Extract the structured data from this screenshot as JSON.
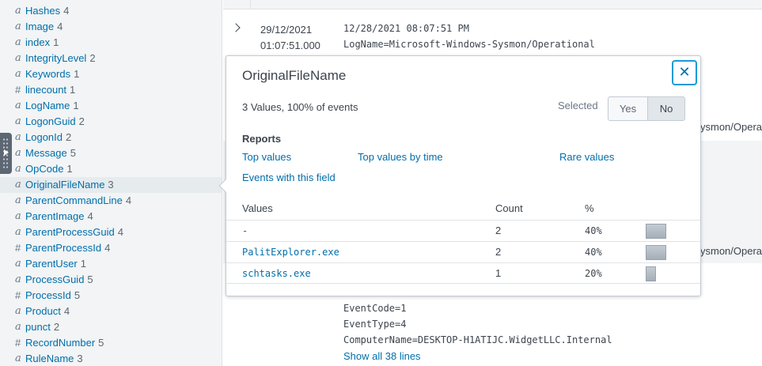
{
  "sidebar": {
    "fields": [
      {
        "type": "a",
        "name": "Hashes",
        "count": "4"
      },
      {
        "type": "a",
        "name": "Image",
        "count": "4"
      },
      {
        "type": "a",
        "name": "index",
        "count": "1"
      },
      {
        "type": "a",
        "name": "IntegrityLevel",
        "count": "2"
      },
      {
        "type": "a",
        "name": "Keywords",
        "count": "1"
      },
      {
        "type": "#",
        "name": "linecount",
        "count": "1"
      },
      {
        "type": "a",
        "name": "LogName",
        "count": "1"
      },
      {
        "type": "a",
        "name": "LogonGuid",
        "count": "2"
      },
      {
        "type": "a",
        "name": "LogonId",
        "count": "2"
      },
      {
        "type": "a",
        "name": "Message",
        "count": "5"
      },
      {
        "type": "a",
        "name": "OpCode",
        "count": "1"
      },
      {
        "type": "a",
        "name": "OriginalFileName",
        "count": "3"
      },
      {
        "type": "a",
        "name": "ParentCommandLine",
        "count": "4"
      },
      {
        "type": "a",
        "name": "ParentImage",
        "count": "4"
      },
      {
        "type": "a",
        "name": "ParentProcessGuid",
        "count": "4"
      },
      {
        "type": "#",
        "name": "ParentProcessId",
        "count": "4"
      },
      {
        "type": "a",
        "name": "ParentUser",
        "count": "1"
      },
      {
        "type": "a",
        "name": "ProcessGuid",
        "count": "5"
      },
      {
        "type": "#",
        "name": "ProcessId",
        "count": "5"
      },
      {
        "type": "a",
        "name": "Product",
        "count": "4"
      },
      {
        "type": "a",
        "name": "punct",
        "count": "2"
      },
      {
        "type": "#",
        "name": "RecordNumber",
        "count": "5"
      },
      {
        "type": "a",
        "name": "RuleName",
        "count": "3"
      }
    ]
  },
  "event": {
    "date": "29/12/2021",
    "time": "01:07:51.000",
    "lines": [
      "12/28/2021 08:07:51 PM",
      "LogName=Microsoft-Windows-Sysmon/Operational"
    ],
    "lines_bottom": [
      "EventCode=1",
      "EventType=4",
      "ComputerName=DESKTOP-H1ATIJC.WidgetLLC.Internal"
    ],
    "right_fragment_1": "ysmon/Opera",
    "right_fragment_2": "ysmon/Opera",
    "show_all": "Show all 38 lines"
  },
  "popover": {
    "title": "OriginalFileName",
    "close_glyph": "✕",
    "summary": "3 Values, 100% of events",
    "selected_label": "Selected",
    "yes_label": "Yes",
    "no_label": "No",
    "reports_title": "Reports",
    "links": {
      "top_values": "Top values",
      "top_values_by_time": "Top values by time",
      "rare_values": "Rare values",
      "events_with_field": "Events with this field"
    },
    "table": {
      "headers": {
        "values": "Values",
        "count": "Count",
        "pct": "%"
      },
      "rows": [
        {
          "value": "-",
          "count": "2",
          "pct": "40%",
          "share": 0.4
        },
        {
          "value": "PalitExplorer.exe",
          "count": "2",
          "pct": "40%",
          "share": 0.4
        },
        {
          "value": "schtasks.exe",
          "count": "1",
          "pct": "20%",
          "share": 0.2
        }
      ]
    }
  },
  "colors": {
    "link": "#006eaa",
    "focus": "#1a9bd7",
    "sidebar_bg": "#f2f4f5"
  }
}
